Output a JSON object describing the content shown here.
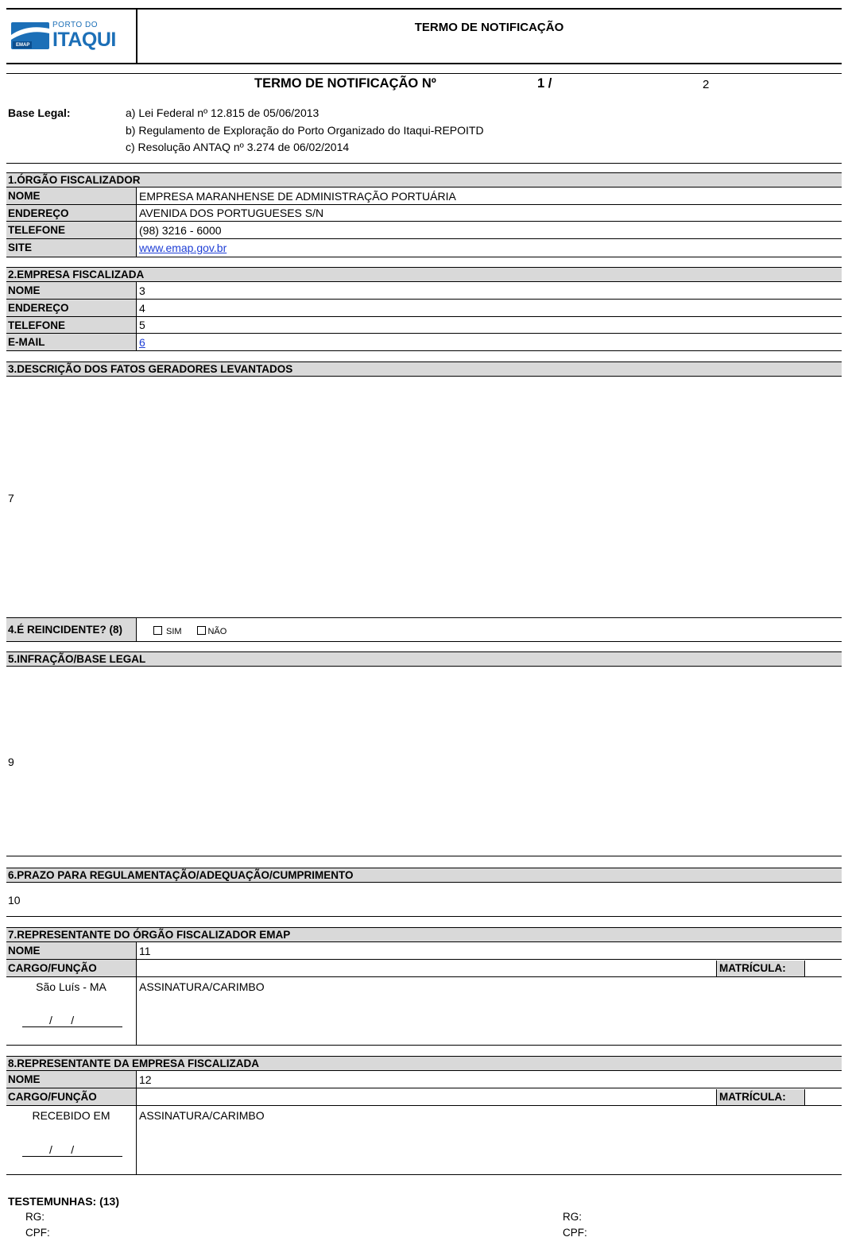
{
  "header": {
    "logo_small_text": "PORTO DO",
    "logo_big_text": "ITAQUI",
    "logo_badge_text": "EMAP",
    "title": "TERMO DE NOTIFICAÇÃO"
  },
  "notif": {
    "label": "TERMO DE NOTIFICAÇÃO Nº",
    "number_1": "1 /",
    "number_2": "2"
  },
  "base_legal": {
    "label": "Base Legal:",
    "items": [
      "a) Lei Federal nº 12.815 de 05/06/2013",
      "b) Regulamento de Exploração do Porto Organizado do Itaqui-REPOITD",
      "c) Resolução ANTAQ nº 3.274 de 06/02/2014"
    ]
  },
  "s1": {
    "title": "1.ÓRGÃO FISCALIZADOR",
    "rows": [
      {
        "label": "NOME",
        "value": "EMPRESA MARANHENSE DE ADMINISTRAÇÃO PORTUÁRIA"
      },
      {
        "label": "ENDEREÇO",
        "value": "AVENIDA DOS PORTUGUESES S/N"
      },
      {
        "label": "TELEFONE",
        "value": "(98) 3216 - 6000"
      },
      {
        "label": "SITE",
        "value": "www.emap.gov.br"
      }
    ]
  },
  "s2": {
    "title": "2.EMPRESA FISCALIZADA",
    "rows": [
      {
        "label": "NOME",
        "value": "3"
      },
      {
        "label": "ENDEREÇO",
        "value": "4"
      },
      {
        "label": "TELEFONE",
        "value": "5"
      },
      {
        "label": "E-MAIL",
        "value": "6"
      }
    ]
  },
  "s3": {
    "title": "3.DESCRIÇÃO DOS FATOS GERADORES LEVANTADOS",
    "value": "7"
  },
  "s4": {
    "title": "4.É REINCIDENTE? (8)",
    "sim": "SIM",
    "nao": "NÃO"
  },
  "s5": {
    "title": "5.INFRAÇÃO/BASE LEGAL",
    "value": "9"
  },
  "s6": {
    "title": "6.PRAZO PARA REGULAMENTAÇÃO/ADEQUAÇÃO/CUMPRIMENTO",
    "value": "10"
  },
  "s7": {
    "title": "7.REPRESENTANTE DO ÓRGÃO FISCALIZADOR EMAP",
    "nome_label": "NOME",
    "nome_value": "11",
    "cargo_label": "CARGO/FUNÇÃO",
    "matricula_label": "MATRÍCULA:",
    "place": "São Luís - MA",
    "date_slashes": "/      /",
    "sign_label": "ASSINATURA/CARIMBO"
  },
  "s8": {
    "title": "8.REPRESENTANTE DA EMPRESA FISCALIZADA",
    "nome_label": "NOME",
    "nome_value": "12",
    "cargo_label": "CARGO/FUNÇÃO",
    "matricula_label": "MATRÍCULA:",
    "place": "RECEBIDO EM",
    "date_slashes": "/      /",
    "sign_label": "ASSINATURA/CARIMBO"
  },
  "witnesses": {
    "title": "TESTEMUNHAS: (13)",
    "rg": "RG:",
    "cpf": "CPF:"
  }
}
